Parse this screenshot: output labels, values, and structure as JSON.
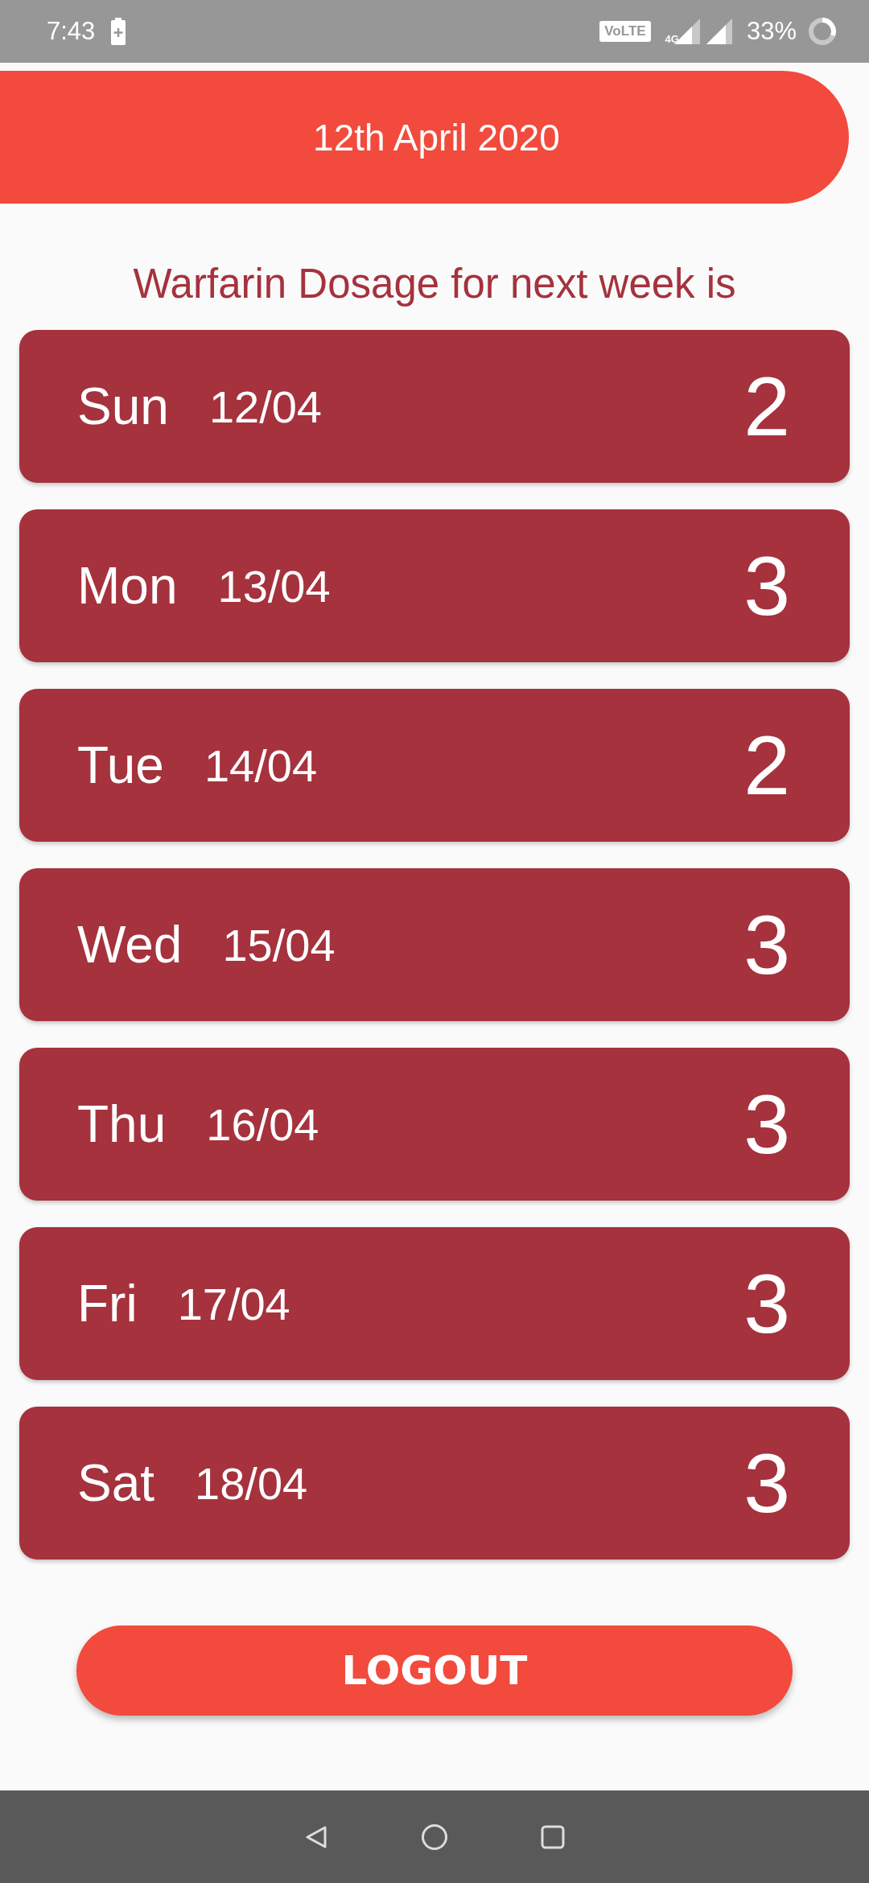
{
  "status_bar": {
    "time": "7:43",
    "volte": "VoLTE",
    "network": "4G",
    "battery": "33%"
  },
  "header": {
    "date": "12th April 2020"
  },
  "heading": "Warfarin Dosage for next week is",
  "days": [
    {
      "day": "Sun",
      "date": "12/04",
      "dose": "2"
    },
    {
      "day": "Mon",
      "date": "13/04",
      "dose": "3"
    },
    {
      "day": "Tue",
      "date": "14/04",
      "dose": "2"
    },
    {
      "day": "Wed",
      "date": "15/04",
      "dose": "3"
    },
    {
      "day": "Thu",
      "date": "16/04",
      "dose": "3"
    },
    {
      "day": "Fri",
      "date": "17/04",
      "dose": "3"
    },
    {
      "day": "Sat",
      "date": "18/04",
      "dose": "3"
    }
  ],
  "logout_button": "LOGOUT"
}
